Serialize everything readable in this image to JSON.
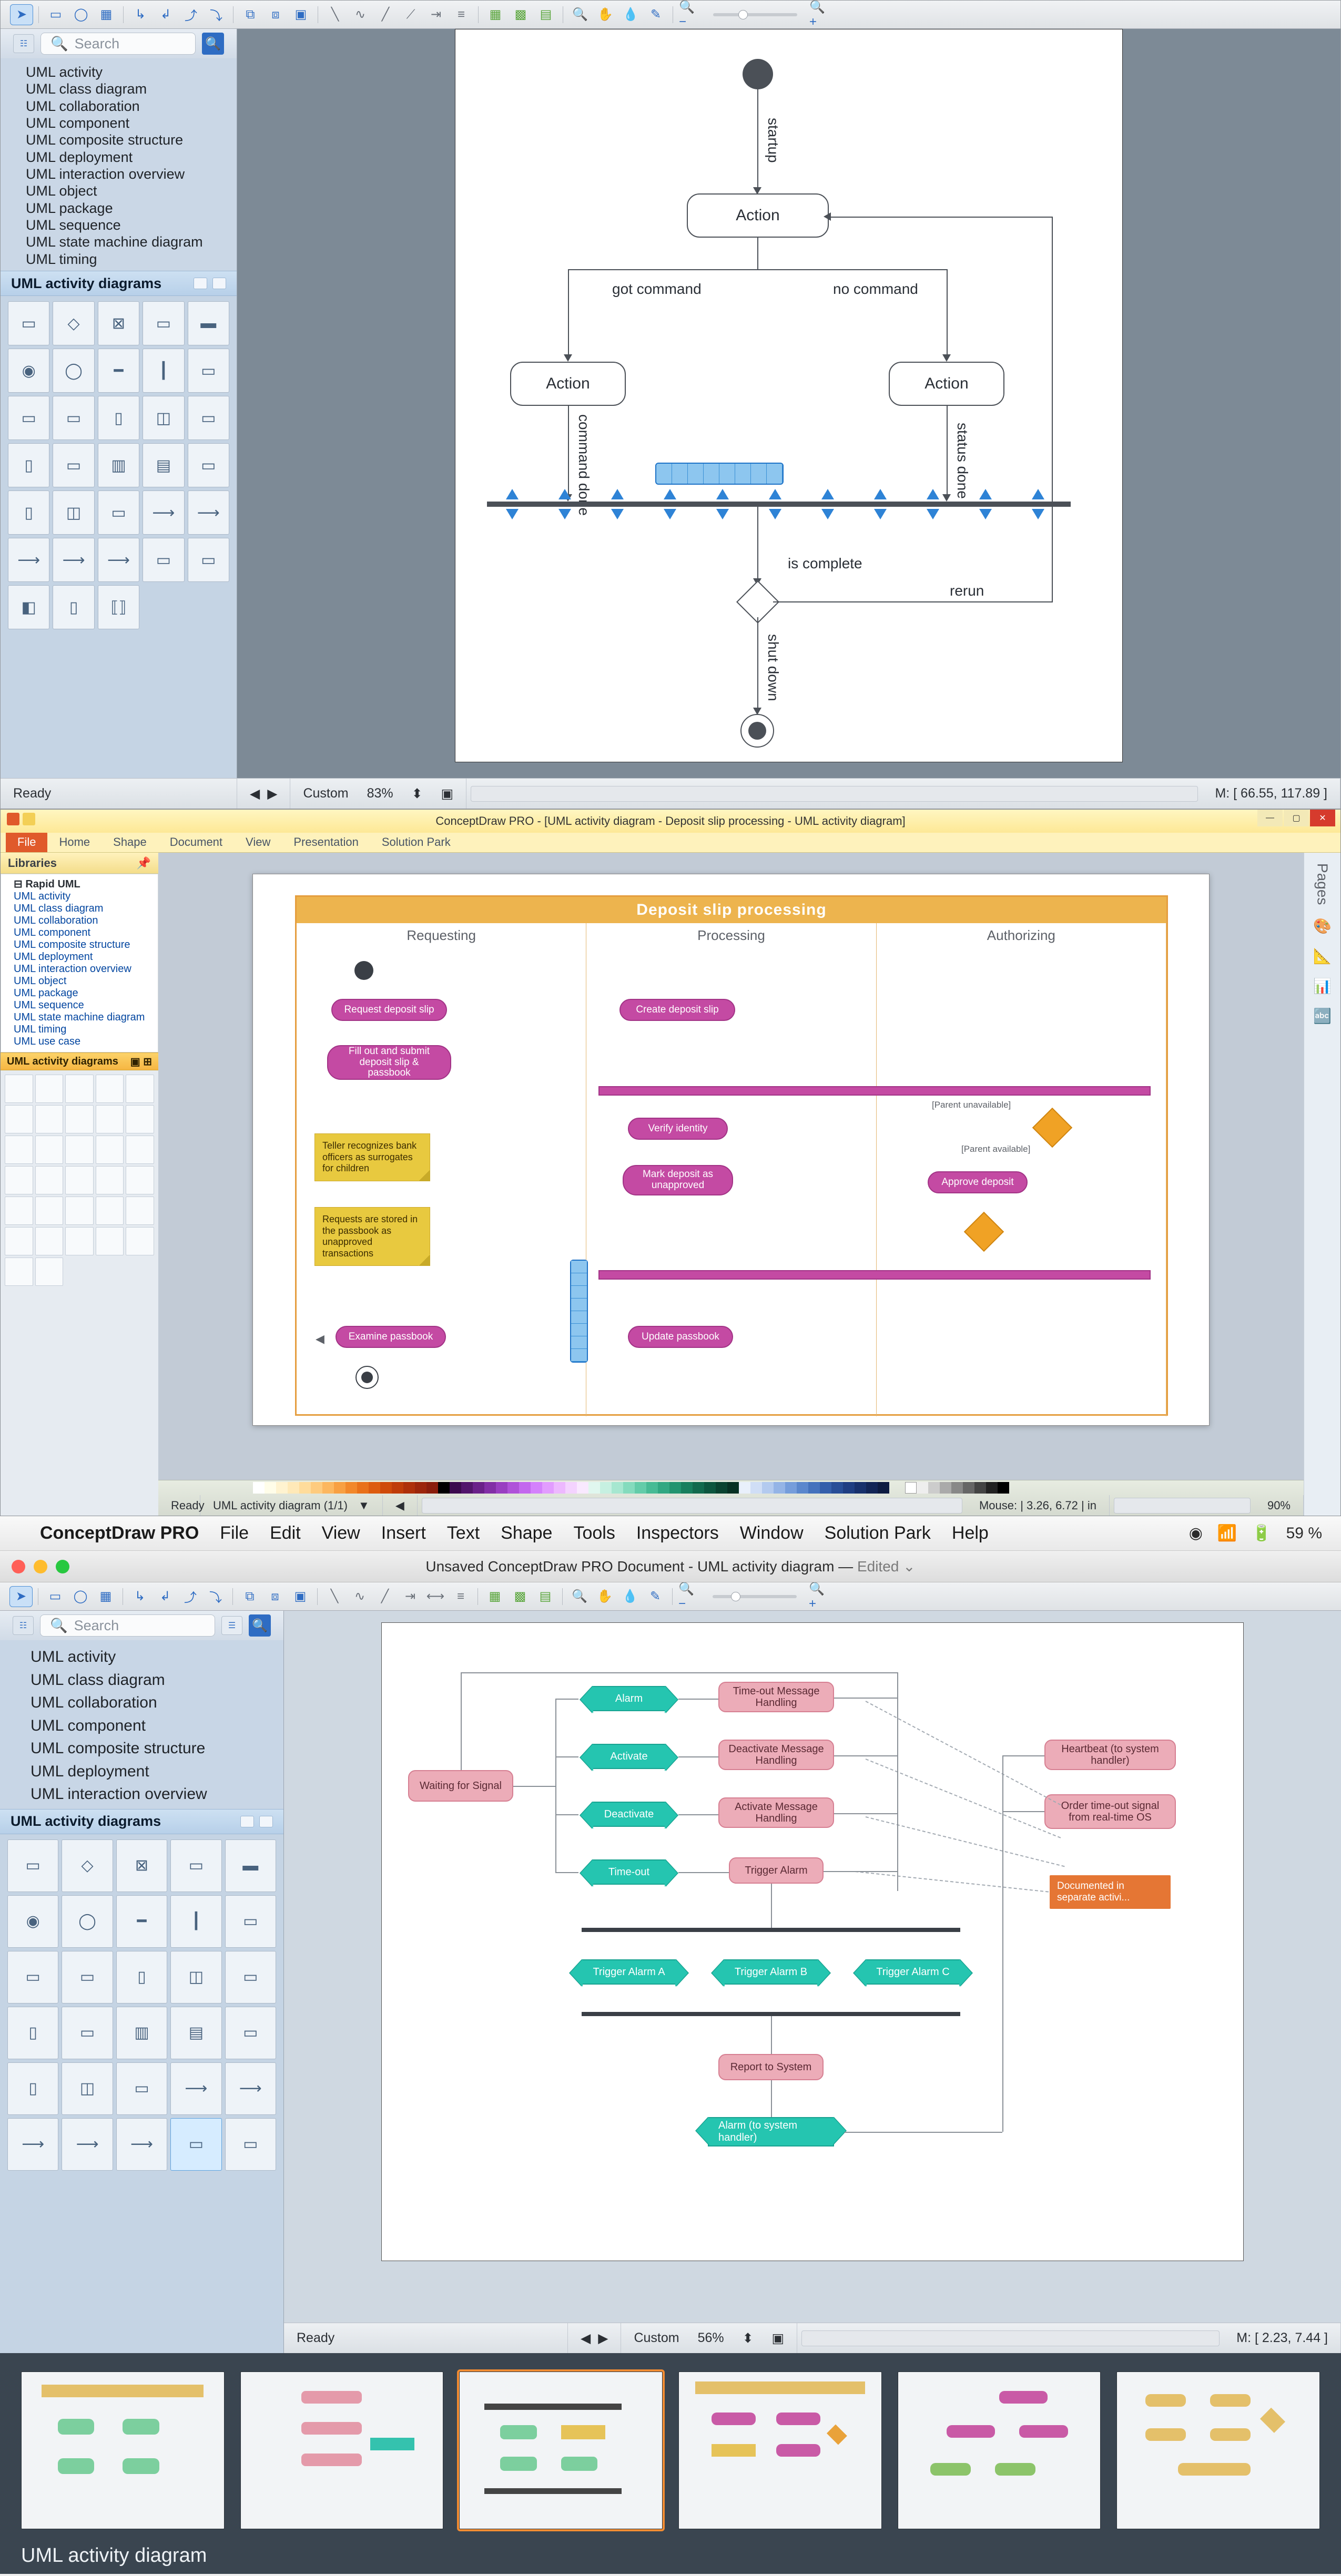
{
  "toolbar": {
    "zoom1": "83%",
    "zoomLabel1": "Custom",
    "zoom3": "56%",
    "zoomLabel3": "Custom"
  },
  "search": {
    "placeholder": "Search"
  },
  "sidebar": {
    "items": [
      "UML activity",
      "UML class diagram",
      "UML collaboration",
      "UML component",
      "UML composite structure",
      "UML deployment",
      "UML interaction overview",
      "UML object",
      "UML package",
      "UML sequence",
      "UML state machine diagram",
      "UML timing"
    ],
    "paletteTitle": "UML activity diagrams"
  },
  "diagram1": {
    "startup": "startup",
    "action": "Action",
    "gotCommand": "got command",
    "noCommand": "no command",
    "commandDone": "command done",
    "statusDone": "status done",
    "isComplete": "is complete",
    "rerun": "rerun",
    "shutdown": "shut down"
  },
  "status1": {
    "ready": "Ready",
    "mouse": "M: [ 66.55, 117.89 ]"
  },
  "pane2": {
    "title": "ConceptDraw PRO - [UML activity diagram - Deposit slip processing - UML activity diagram]",
    "ribbon": [
      "File",
      "Home",
      "Shape",
      "Document",
      "View",
      "Presentation",
      "Solution Park"
    ],
    "libHeader": "Libraries",
    "treeRoot": "Rapid UML",
    "tree": [
      "UML activity",
      "UML class diagram",
      "UML collaboration",
      "UML component",
      "UML composite structure",
      "UML deployment",
      "UML interaction overview",
      "UML object",
      "UML package",
      "UML sequence",
      "UML state machine diagram",
      "UML timing",
      "UML use case"
    ],
    "paletteTitle": "UML activity diagrams",
    "diagram": {
      "title": "Deposit slip processing",
      "lanes": [
        "Requesting",
        "Processing",
        "Authorizing"
      ],
      "request": "Request deposit slip",
      "create": "Create deposit slip",
      "fill": "Fill out and submit deposit slip & passbook",
      "verify": "Verify identity",
      "mark": "Mark deposit as unapproved",
      "approve": "Approve deposit",
      "examine": "Examine passbook",
      "update": "Update passbook",
      "note1": "Teller recognizes bank officers as surrogates for children",
      "note2": "Requests are stored in the passbook as unapproved transactions",
      "parentUnavail": "[Parent unavailable]",
      "parentAvail": "[Parent available]"
    },
    "footerPage": "UML activity diagram (1/1)",
    "footerMouse": "Mouse: | 3.26, 6.72 | in",
    "footerZoom": "90%",
    "status": "Ready"
  },
  "pane3": {
    "menus": [
      "File",
      "Edit",
      "View",
      "Insert",
      "Text",
      "Shape",
      "Tools",
      "Inspectors",
      "Window",
      "Solution Park",
      "Help"
    ],
    "appName": "ConceptDraw PRO",
    "battery": "59 %",
    "title": "Unsaved ConceptDraw PRO Document - UML activity diagram",
    "edited": "Edited",
    "sidebar": [
      "UML activity",
      "UML class diagram",
      "UML collaboration",
      "UML component",
      "UML composite structure",
      "UML deployment",
      "UML interaction overview"
    ],
    "paletteTitle": "UML activity diagrams",
    "diagram": {
      "waiting": "Waiting for Signal",
      "alarm": "Alarm",
      "activate": "Activate",
      "deactivate": "Deactivate",
      "timeout": "Time-out",
      "timeoutMsg": "Time-out Message Handling",
      "deactMsg": "Deactivate Message Handling",
      "actMsg": "Activate Message Handling",
      "trigger": "Trigger Alarm",
      "heartbeat": "Heartbeat (to system handler)",
      "orderTimeout": "Order time-out signal from real-time OS",
      "triggerA": "Trigger Alarm A",
      "triggerB": "Trigger Alarm B",
      "triggerC": "Trigger Alarm C",
      "report": "Report to System",
      "alarmSys": "Alarm (to system handler)",
      "note": "Documented in separate activi..."
    },
    "status": {
      "ready": "Ready",
      "mouse": "M: [ 2.23, 7.44 ]"
    }
  },
  "gallery": {
    "caption": "UML activity diagram"
  }
}
